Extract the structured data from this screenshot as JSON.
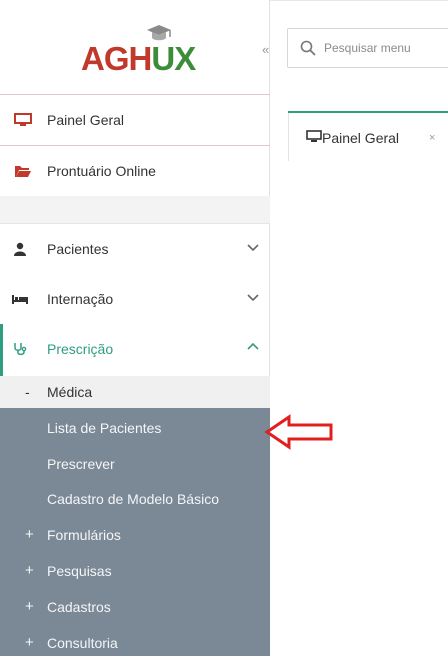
{
  "logo": {
    "text_a": "AGH",
    "text_u": "U",
    "text_x": "X"
  },
  "sidebar": {
    "collapse_glyph": "«",
    "top_items": [
      {
        "label": "Painel Geral",
        "icon": "monitor-icon"
      },
      {
        "label": "Prontuário Online",
        "icon": "folder-open-icon"
      }
    ],
    "sections": [
      {
        "label": "Pacientes",
        "icon": "user-icon",
        "expanded": false
      },
      {
        "label": "Internação",
        "icon": "bed-icon",
        "expanded": false
      },
      {
        "label": "Prescrição",
        "icon": "stethoscope-icon",
        "expanded": true
      }
    ],
    "submenu": {
      "label": "Médica",
      "prefix": "-",
      "items": [
        {
          "label": "Lista de Pacientes"
        },
        {
          "label": "Prescrever"
        },
        {
          "label": "Cadastro de Modelo Básico"
        }
      ],
      "groups": [
        {
          "prefix": "+",
          "label": "Formulários"
        },
        {
          "prefix": "+",
          "label": "Pesquisas"
        },
        {
          "prefix": "+",
          "label": "Cadastros"
        },
        {
          "prefix": "+",
          "label": "Consultoria"
        }
      ]
    }
  },
  "search": {
    "placeholder": "Pesquisar menu"
  },
  "tabs": [
    {
      "label": "Painel Geral",
      "close": "×"
    }
  ],
  "colors": {
    "accent": "#2f9e80",
    "logo_red": "#c0392b",
    "logo_green": "#3c8c3a",
    "submenu_bg": "#7b8895",
    "arrow": "#e02020"
  }
}
